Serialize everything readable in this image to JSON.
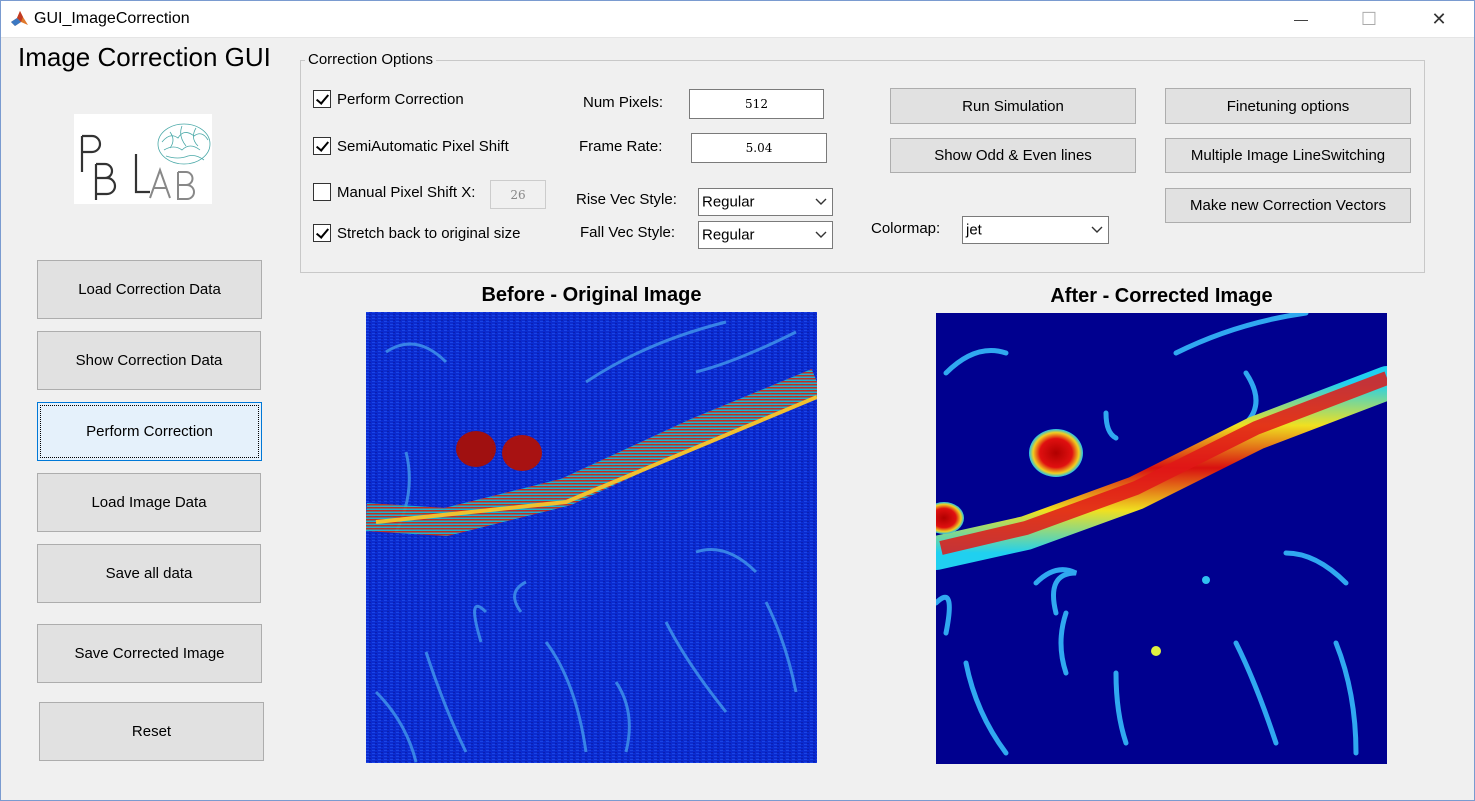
{
  "window": {
    "title": "GUI_ImageCorrection",
    "minimize_glyph": "—",
    "maximize_glyph": "☐",
    "close_glyph": "✕"
  },
  "app": {
    "heading": "Image Correction GUI",
    "logo_text": "PBLAB"
  },
  "sidebar": {
    "buttons": [
      {
        "label": "Load Correction Data"
      },
      {
        "label": "Show Correction Data"
      },
      {
        "label": "Perform Correction"
      },
      {
        "label": "Load Image Data"
      },
      {
        "label": "Save all data"
      },
      {
        "label": "Save Corrected Image"
      },
      {
        "label": "Reset"
      }
    ]
  },
  "options": {
    "panel_title": "Correction Options",
    "checkboxes": [
      {
        "label": "Perform Correction",
        "checked": true
      },
      {
        "label": "SemiAutomatic Pixel Shift",
        "checked": true
      },
      {
        "label": "Manual Pixel Shift X:",
        "checked": false
      },
      {
        "label": "Stretch back to original size",
        "checked": true
      }
    ],
    "manual_shift_value": "26",
    "num_pixels_label": "Num Pixels:",
    "num_pixels_value": "512",
    "frame_rate_label": "Frame Rate:",
    "frame_rate_value": "5.04",
    "rise_vec_label": "Rise Vec Style:",
    "rise_vec_value": "Regular",
    "fall_vec_label": "Fall Vec Style:",
    "fall_vec_value": "Regular",
    "colormap_label": "Colormap:",
    "colormap_value": "jet",
    "buttons": {
      "run_simulation": "Run Simulation",
      "show_odd_even": "Show Odd & Even lines",
      "finetuning": "Finetuning options",
      "multiple_switching": "Multiple Image LineSwitching",
      "make_vectors": "Make new Correction Vectors"
    }
  },
  "images": {
    "before_title": "Before - Original Image",
    "after_title": "After - Corrected Image"
  },
  "colors": {
    "jet_dark": "#00008f",
    "jet_blue": "#0a2fd8",
    "jet_red": "#b80000",
    "accent_border": "#0078d7"
  }
}
